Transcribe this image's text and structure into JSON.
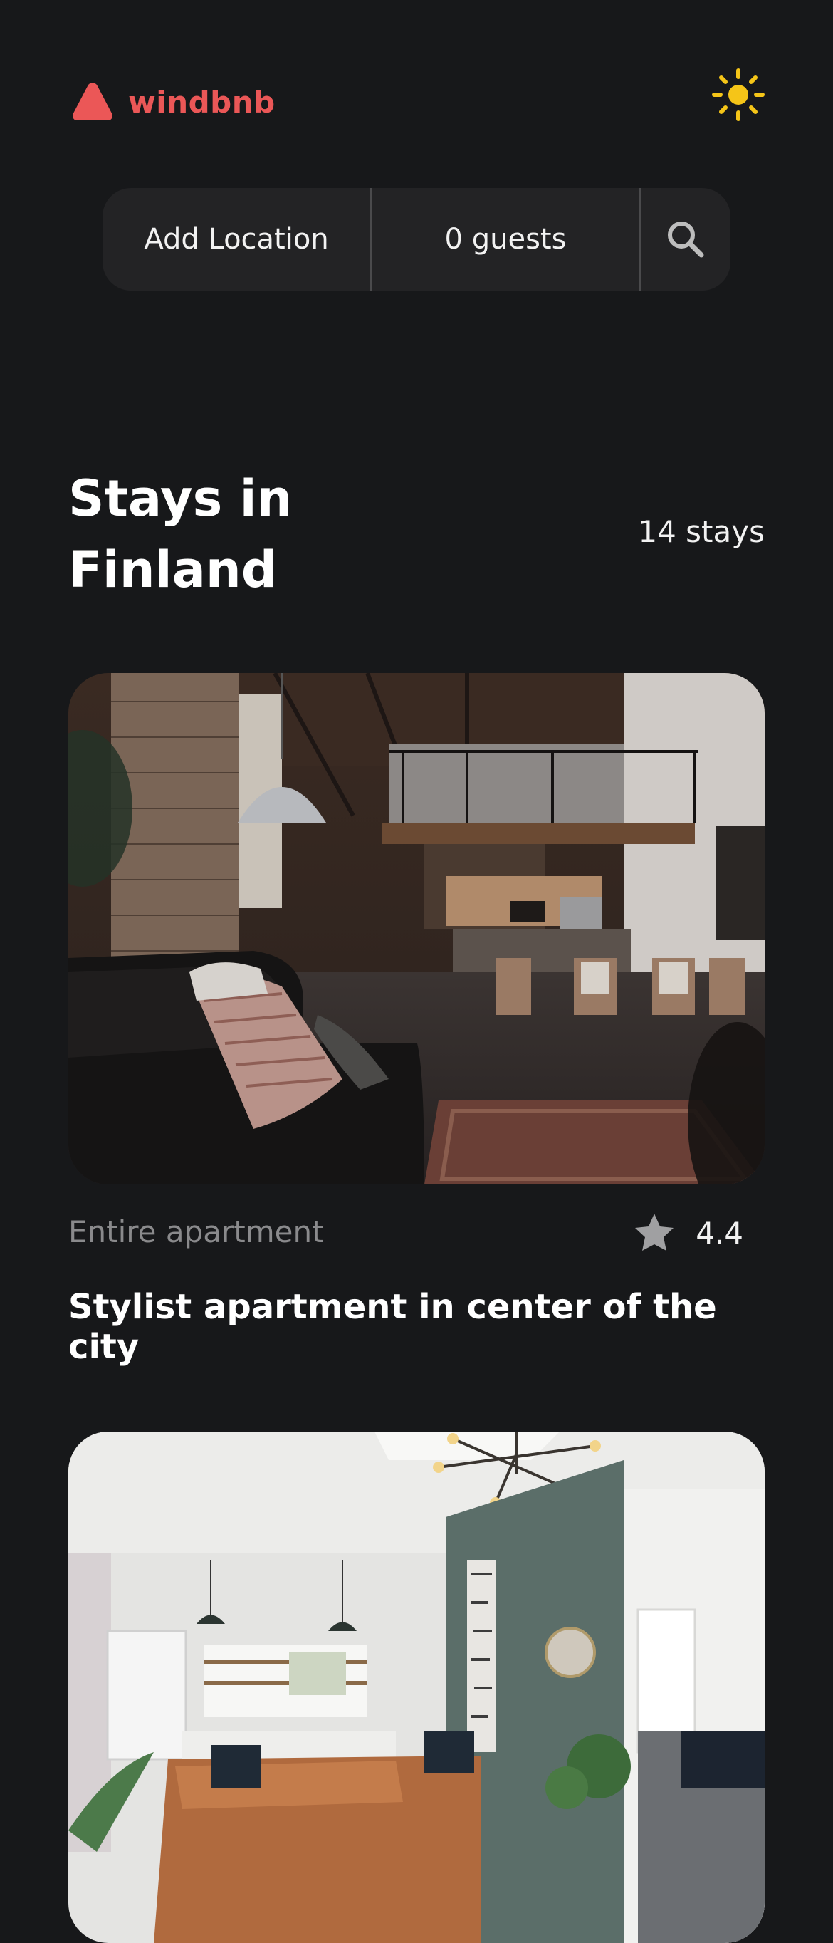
{
  "header": {
    "brand_name": "windbnb",
    "logo_icon": "triangle-logo-icon",
    "theme_toggle_icon": "sun-icon",
    "brand_color": "#eb5757",
    "sun_color": "#f5c518"
  },
  "search": {
    "location_label": "Add Location",
    "guests_label": "0 guests",
    "search_icon": "search-icon"
  },
  "section": {
    "title": "Stays in Finland",
    "count": "14 stays"
  },
  "stays": [
    {
      "type": "Entire apartment",
      "rating": "4.4",
      "title": "Stylist apartment in center of the city",
      "image": "loft-living-room-photo"
    },
    {
      "image": "bright-living-room-photo"
    }
  ],
  "colors": {
    "background": "#17181a",
    "search_bg": "#232325",
    "muted_text": "#8a8a8c",
    "star": "#a0a0a2"
  }
}
